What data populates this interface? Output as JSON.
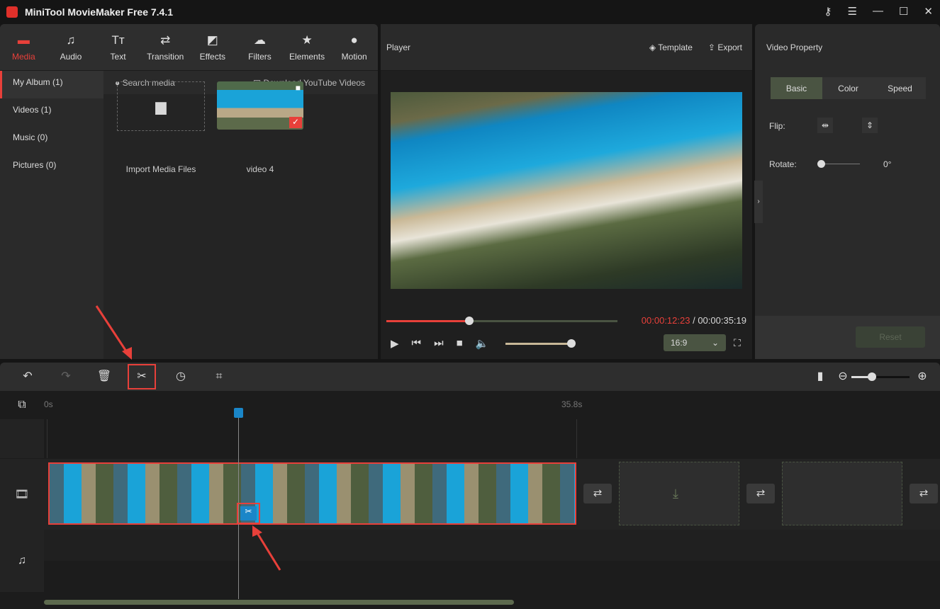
{
  "app": {
    "title": "MiniTool MovieMaker Free 7.4.1"
  },
  "tabs": [
    {
      "label": "Media",
      "icon": "folder-icon"
    },
    {
      "label": "Audio",
      "icon": "music-icon"
    },
    {
      "label": "Text",
      "icon": "text-icon"
    },
    {
      "label": "Transition",
      "icon": "transition-icon"
    },
    {
      "label": "Effects",
      "icon": "effects-icon"
    },
    {
      "label": "Filters",
      "icon": "filters-icon"
    },
    {
      "label": "Elements",
      "icon": "elements-icon"
    },
    {
      "label": "Motion",
      "icon": "motion-icon"
    }
  ],
  "sidebar": [
    {
      "label": "My Album (1)"
    },
    {
      "label": "Videos (1)"
    },
    {
      "label": "Music (0)"
    },
    {
      "label": "Pictures (0)"
    }
  ],
  "media": {
    "search_placeholder": "Search media",
    "download": "Download YouTube Videos",
    "import": "Import Media Files",
    "item": "video 4"
  },
  "player": {
    "title": "Player",
    "template": "Template",
    "export": "Export",
    "current": "00:00:12:23",
    "total": "/ 00:00:35:19",
    "progress": 0.36,
    "volume": 1.0,
    "aspect": "16:9"
  },
  "property": {
    "title": "Video Property",
    "tabs": [
      "Basic",
      "Color",
      "Speed"
    ],
    "flip": "Flip:",
    "rotate": "Rotate:",
    "rotate_value": "0°",
    "reset": "Reset"
  },
  "timeline": {
    "start": "0s",
    "end": "35.8s",
    "zoom": 0.35
  },
  "accent": "#e8403a"
}
